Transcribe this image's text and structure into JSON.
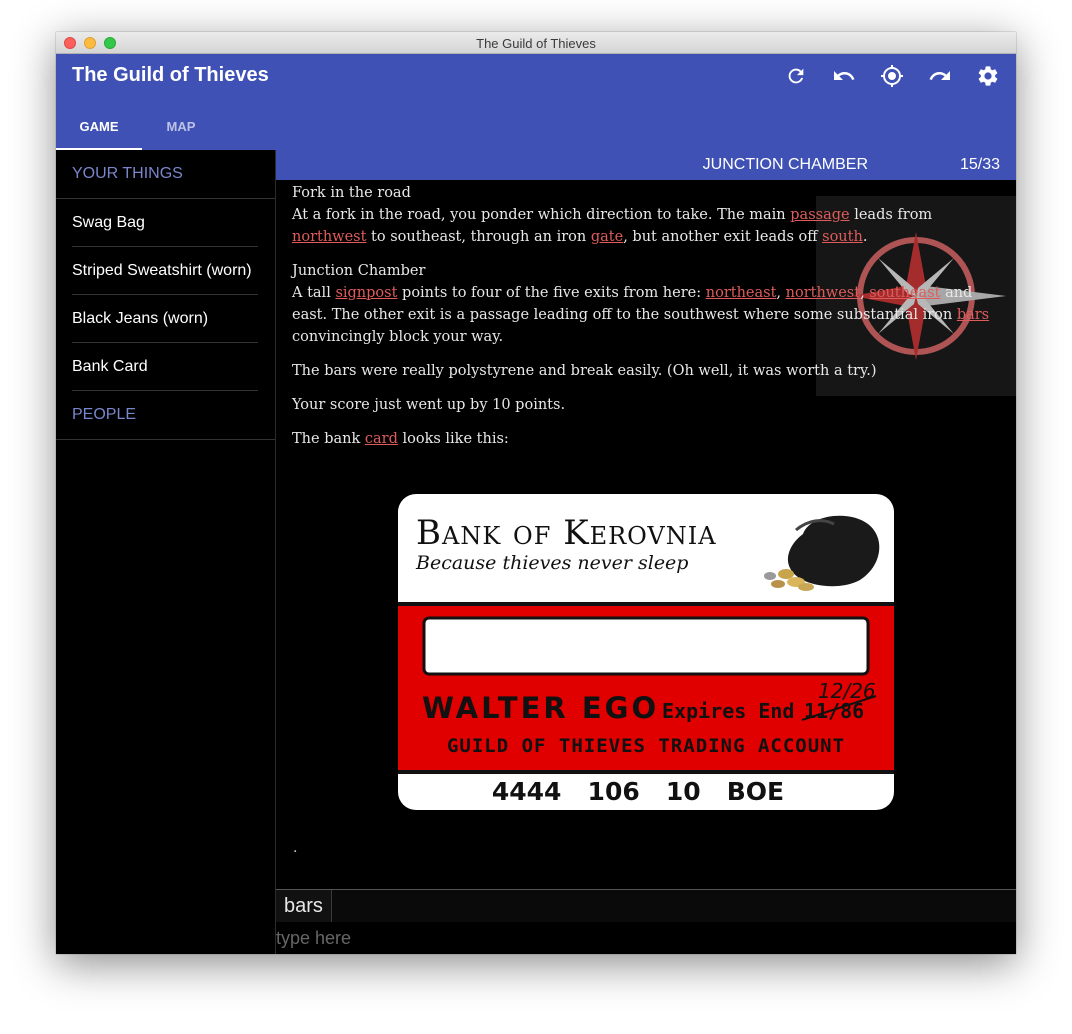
{
  "window": {
    "title": "The Guild of Thieves"
  },
  "appbar": {
    "title": "The Guild of Thieves",
    "tabs": [
      {
        "label": "GAME"
      },
      {
        "label": "MAP"
      }
    ]
  },
  "toolbar": {
    "icons": [
      "refresh-icon",
      "undo-icon",
      "locate-icon",
      "redo-icon",
      "settings-icon"
    ]
  },
  "sidebar": {
    "things_header": "YOUR THINGS",
    "items": [
      {
        "label": "Swag Bag"
      },
      {
        "label": "Striped Sweatshirt (worn)"
      },
      {
        "label": "Black Jeans (worn)"
      },
      {
        "label": "Bank Card"
      }
    ],
    "people_header": "PEOPLE"
  },
  "location": {
    "name": "JUNCTION CHAMBER",
    "score": "15/33"
  },
  "transcript": {
    "p1_title": "Fork in the road",
    "p1_a": "At a fork in the road, you ponder which direction to take. The main ",
    "p1_l1": "passage",
    "p1_b": " leads from ",
    "p1_l2": "northwest",
    "p1_c": " to southeast, through an iron ",
    "p1_l3": "gate",
    "p1_d": ", but another exit leads off ",
    "p1_l4": "south",
    "p1_e": ".",
    "p2_title": "Junction Chamber",
    "p2_a": "A tall ",
    "p2_l1": "signpost",
    "p2_b": " points to four of the five exits from here: ",
    "p2_l2": "northeast",
    "p2_c": ", ",
    "p2_l3": "northwest",
    "p2_d": ", ",
    "p2_l4": "southeast",
    "p2_e": " and east. The other exit is a passage leading off to the southwest where some substantial iron ",
    "p2_l5": "bars",
    "p2_f": " convincingly block your way.",
    "p3": "The bars were really polystyrene and break easily. (Oh well, it was worth a try.)",
    "p4": "Your score just went up by 10 points.",
    "p5_a": "The bank ",
    "p5_l1": "card",
    "p5_b": " looks like this:",
    "tail": "."
  },
  "bank_card": {
    "bank_name": "Bank of Kerovnia",
    "slogan": "Because thieves never sleep",
    "holder": "WALTER EGO",
    "expires_label": "Expires End",
    "expires_old": "11/86",
    "expires_new": "12/26",
    "account_type": "GUILD OF THIEVES TRADING ACCOUNT",
    "number": "4444   106   10   BOE"
  },
  "command": {
    "last": "bars",
    "placeholder": "type here"
  },
  "colors": {
    "primary": "#3f51b5",
    "accent_text": "#7986cb",
    "link": "#e05c5c",
    "card_red": "#e00000"
  }
}
